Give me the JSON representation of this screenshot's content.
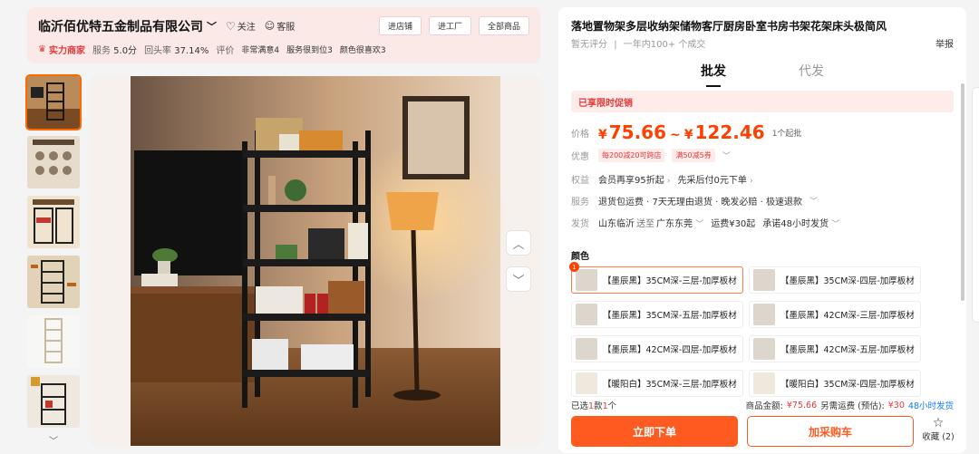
{
  "shop": {
    "name": "临沂佰优特五金制品有限公司",
    "follow": "关注",
    "service": "客服",
    "buttons": [
      "进店铺",
      "进工厂",
      "全部商品"
    ],
    "strength_badge": "实力商家",
    "service_label": "服务",
    "service_score": "5.0分",
    "repeat_label": "回头率",
    "repeat_rate": "37.14%",
    "review_label": "评价",
    "tags": [
      "非常满意4",
      "服务很到位3",
      "颜色很喜欢3"
    ]
  },
  "gallery": {
    "thumb_count": 7,
    "selected_index": 0
  },
  "product": {
    "title": "落地置物架多层收纳架储物客厅厨房卧室书房书架花架床头极简风",
    "no_rating": "暂无评分",
    "sales": "一年内100+ 个成交",
    "sales_highlight": "100+",
    "report": "举报"
  },
  "tabs": [
    {
      "label": "批发",
      "active": true
    },
    {
      "label": "代发",
      "active": false
    }
  ],
  "promo_text": "已享限时促销",
  "price": {
    "label": "价格",
    "currency": "¥",
    "low": "75.66",
    "high": "122.46",
    "min_order": "1个起批"
  },
  "discount": {
    "label": "优惠",
    "coupons": [
      "每200减20可跨店",
      "满50减5券"
    ]
  },
  "benefits": {
    "label": "权益",
    "items": [
      "会员再享95折起",
      "先采后付0元下单"
    ]
  },
  "service": {
    "label": "服务",
    "text": "退货包运费 · 7天无理由退货 · 晚发必赔 · 极速退款"
  },
  "shipping": {
    "label": "发货",
    "from": "山东临沂",
    "to_word": "送至",
    "to": "广东东莞",
    "freight": "运费¥30起",
    "promise": "承诺48小时发货"
  },
  "color_label": "颜色",
  "variants": [
    {
      "label": "【墨辰黑】35CM深-三层-加厚板材",
      "selected": true,
      "count": "1"
    },
    {
      "label": "【墨辰黑】35CM深-四层-加厚板材",
      "selected": false
    },
    {
      "label": "【墨辰黑】35CM深-五层-加厚板材",
      "selected": false
    },
    {
      "label": "【墨辰黑】42CM深-三层-加厚板材",
      "selected": false
    },
    {
      "label": "【墨辰黑】42CM深-四层-加厚板材",
      "selected": false
    },
    {
      "label": "【墨辰黑】42CM深-五层-加厚板材",
      "selected": false
    },
    {
      "label": "【暖阳白】35CM深-三层-加厚板材",
      "selected": false
    },
    {
      "label": "【暖阳白】35CM深-四层-加厚板材",
      "selected": false
    }
  ],
  "footer": {
    "selected_prefix": "已选",
    "selected_kinds": "1",
    "selected_mid": "款",
    "selected_count": "1",
    "selected_suffix": "个",
    "amount_label": "商品金额:",
    "amount": "¥75.66",
    "freight_label": "另需运费 (预估):",
    "freight": "¥30",
    "ship_time": "48小时发货"
  },
  "actions": {
    "buy": "立即下单",
    "cart": "加采购车",
    "favorite": "收藏",
    "favorite_count": "(2)"
  },
  "colors": {
    "accent": "#ff5a1f",
    "price": "#ff4000",
    "red": "#e4393c"
  }
}
